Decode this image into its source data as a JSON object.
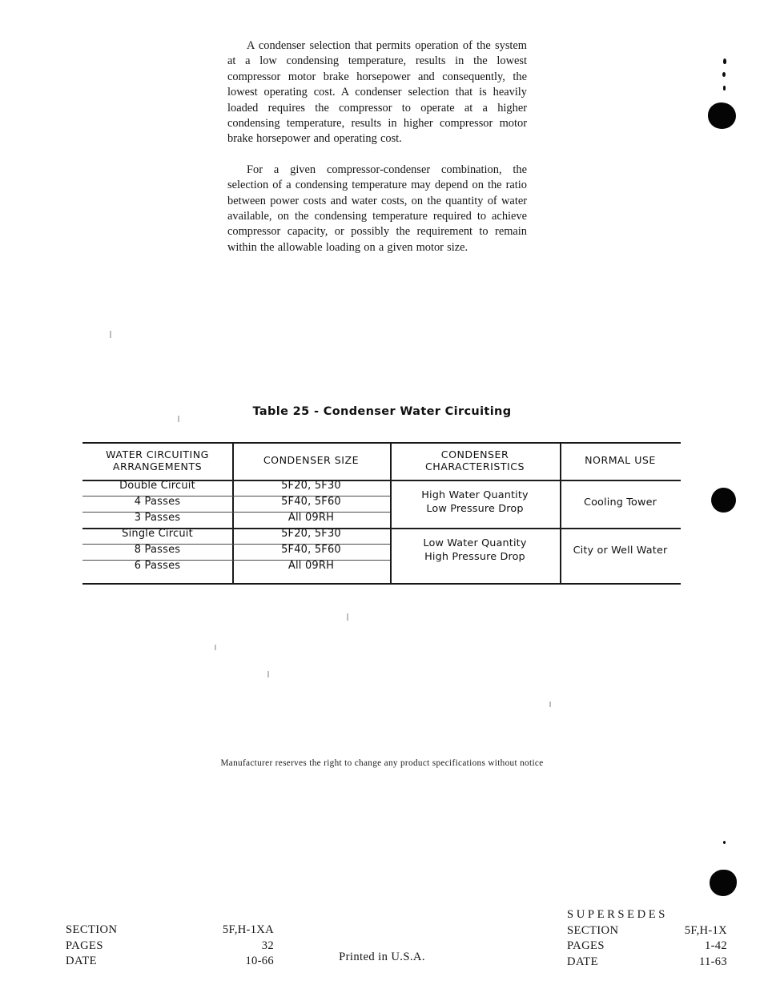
{
  "document": {
    "paragraphs": [
      "A condenser selection that permits operation of the system at a low condensing temperature, results in the lowest compressor motor brake horsepower and consequently, the lowest operating cost. A condenser selection that is heavily loaded requires the compressor to operate at a higher condensing temperature, results in higher compressor motor brake horsepower and operating cost.",
      "For a given compressor-condenser combination, the selection of a condensing temperature may depend on the ratio between power costs and water costs, on the quantity of water available, on the condensing temperature required to achieve compressor capacity, or possibly the requirement to remain within the allowable loading on a given motor size."
    ],
    "disclaimer": "Manufacturer reserves the right to change any product specifications without notice",
    "printed_in": "Printed in U.S.A."
  },
  "table": {
    "title": "Table 25 - Condenser Water Circuiting",
    "headers": [
      "WATER CIRCUITING\nARRANGEMENTS",
      "CONDENSER SIZE",
      "CONDENSER\nCHARACTERISTICS",
      "NORMAL USE"
    ],
    "header_lines": {
      "col1_line1": "WATER CIRCUITING",
      "col1_line2": "ARRANGEMENTS",
      "col2": "CONDENSER SIZE",
      "col3_line1": "CONDENSER",
      "col3_line2": "CHARACTERISTICS",
      "col4": "NORMAL USE"
    },
    "groups": [
      {
        "arrangements": [
          "Double Circuit",
          "4 Passes",
          "3 Passes"
        ],
        "sizes": [
          "5F20, 5F30",
          "5F40, 5F60",
          "All 09RH"
        ],
        "characteristics_line1": "High Water Quantity",
        "characteristics_line2": "Low Pressure Drop",
        "normal_use": "Cooling Tower"
      },
      {
        "arrangements": [
          "Single Circuit",
          "8 Passes",
          "6 Passes"
        ],
        "sizes": [
          "5F20, 5F30",
          "5F40, 5F60",
          "All 09RH"
        ],
        "characteristics_line1": "Low Water Quantity",
        "characteristics_line2": "High Pressure Drop",
        "normal_use": "City or Well Water"
      }
    ]
  },
  "footer_left": {
    "section_label": "SECTION",
    "section_value": "5F,H-1XA",
    "pages_label": "PAGES",
    "pages_value": "32",
    "date_label": "DATE",
    "date_value": "10-66"
  },
  "footer_right": {
    "supersedes": "SUPERSEDES",
    "section_label": "SECTION",
    "section_value": "5F,H-1X",
    "pages_label": "PAGES",
    "pages_value": "1-42",
    "date_label": "DATE",
    "date_value": "11-63"
  },
  "colors": {
    "ink": "#111111",
    "rule": "#181818",
    "page": "#ffffff"
  }
}
